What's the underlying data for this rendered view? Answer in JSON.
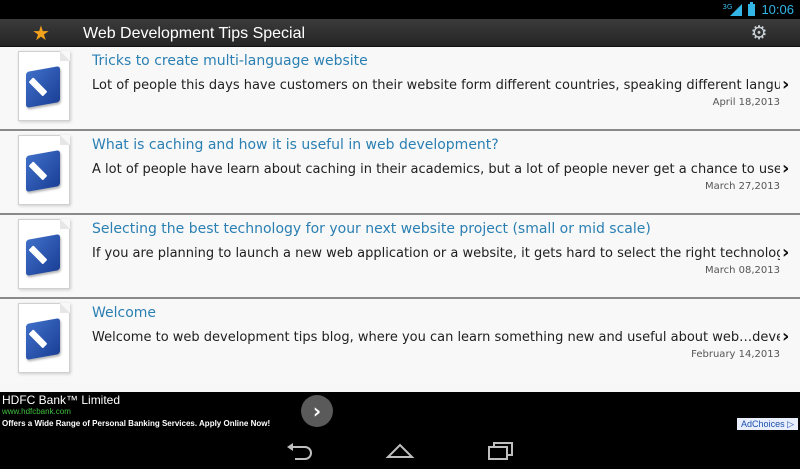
{
  "status_bar": {
    "network": "3G",
    "time": "10:06",
    "icons": [
      "signal-icon",
      "battery-icon"
    ]
  },
  "action_bar": {
    "app_icon": "star-icon",
    "title": "Web Development Tips Special",
    "settings_icon": "gear-icon"
  },
  "posts": [
    {
      "title": "Tricks to create multi-language website",
      "snippet": "Lot of people this days have customers on their website form different countries, speaking different languages....",
      "date": "April 18,2013"
    },
    {
      "title": "What is caching and how it is useful in web development?",
      "snippet": "A lot of people have learn about caching in their academics, but a lot of people never get a chance to use it…espe",
      "date": "March 27,2013"
    },
    {
      "title": "Selecting the best technology for your next website project (small or mid scale)",
      "snippet": "If you are planning to launch a new web application or a website, it gets hard to select the right technology for …I",
      "date": "March 08,2013"
    },
    {
      "title": "Welcome",
      "snippet": "Welcome to web development tips blog, where you can learn something new and useful about web…developmer",
      "date": "February 14,2013"
    }
  ],
  "ad": {
    "title": "HDFC Bank™ Limited",
    "url": "www.hdfcbank.com",
    "description": "Offers a Wide Range of Personal Banking Services. Apply Online Now!",
    "go_glyph": "›",
    "adchoices": "AdChoices ▷"
  },
  "nav": {
    "back": "⟲",
    "home": "⌂",
    "recents": "▭"
  },
  "colors": {
    "accent": "#33b5e5",
    "title_blue": "#2a7fb3",
    "star": "#f3a21c"
  }
}
